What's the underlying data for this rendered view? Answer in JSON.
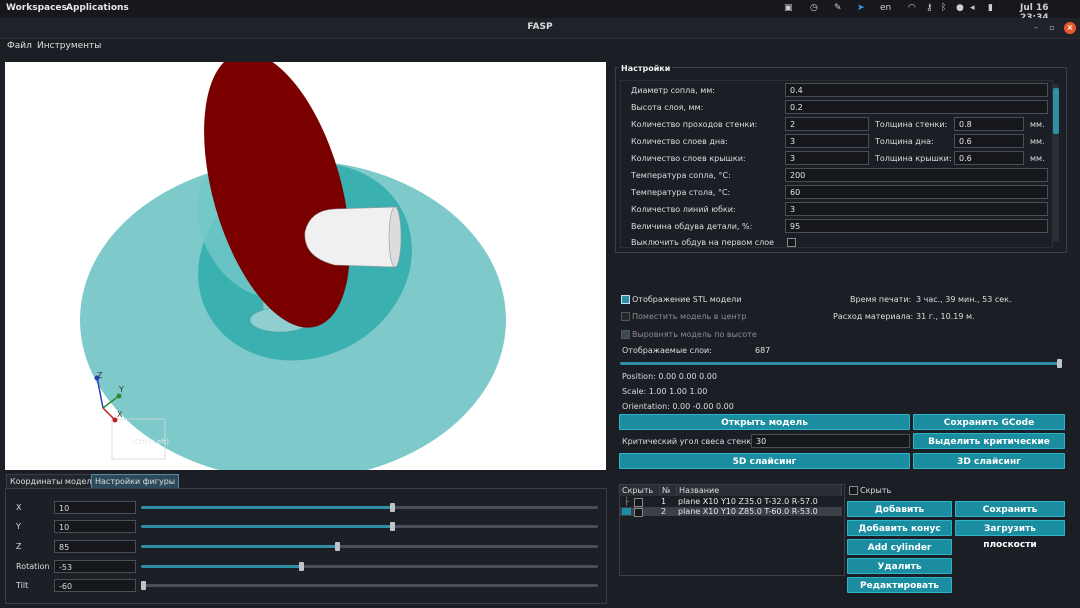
{
  "system_bar": {
    "workspaces": "Workspaces",
    "applications": "Applications",
    "lang": "en",
    "clock": "Jul 16  23:34"
  },
  "window": {
    "title": "FASP"
  },
  "menu": {
    "file": "Файл",
    "tools": "Инструменты"
  },
  "viewport": {
    "corner_label": "(Ctrl+Left)",
    "axis_x": "X",
    "axis_y": "Y",
    "axis_z": "Z"
  },
  "tabs": {
    "model_coords": "Координаты модели",
    "figure_settings": "Настройки фигуры"
  },
  "figure_settings": {
    "rows": [
      {
        "label": "X",
        "value": "10",
        "level": 0.55
      },
      {
        "label": "Y",
        "value": "10",
        "level": 0.55
      },
      {
        "label": "Z",
        "value": "85",
        "level": 0.43
      },
      {
        "label": "Rotation",
        "value": "-53",
        "level": 0.35
      },
      {
        "label": "Tilt",
        "value": "-60",
        "level": 0.0
      }
    ]
  },
  "settings": {
    "title": "Настройки",
    "nozzle_diameter_label": "Диаметр сопла, мм:",
    "nozzle_diameter": "0.4",
    "layer_height_label": "Высота слоя, мм:",
    "layer_height": "0.2",
    "wall_passes_label": "Количество проходов стенки:",
    "wall_passes": "2",
    "wall_thickness_label": "Толщина стенки:",
    "wall_thickness": "0.8",
    "bottom_layers_label": "Количество слоев дна:",
    "bottom_layers": "3",
    "bottom_thickness_label": "Толщина дна:",
    "bottom_thickness": "0.6",
    "top_layers_label": "Количество слоев крышки:",
    "top_layers": "3",
    "top_thickness_label": "Толщина крышки:",
    "top_thickness": "0.6",
    "unit_mm": "мм.",
    "nozzle_temp_label": "Температура сопла, °C:",
    "nozzle_temp": "200",
    "bed_temp_label": "Температура стола, °C:",
    "bed_temp": "60",
    "skirt_lines_label": "Количество линий юбки:",
    "skirt_lines": "3",
    "fan_label": "Величина обдува детали, %:",
    "fan": "95",
    "fan_off_first_label": "Выключить обдув на первом слое"
  },
  "display": {
    "show_stl_label": "Отображение STL модели",
    "center_model_label": "Поместить модель в центр",
    "align_height_label": "Выровнять модель по высоте",
    "layers_label": "Отображаемые слои:",
    "layers_value": "687",
    "layers_level": 1.0,
    "print_time_label": "Время печати:",
    "print_time": "3 час., 39 мин., 53 сек.",
    "material_label": "Расход материала:",
    "material": "31 г., 10.19 м.",
    "position": "Position: 0.00 0.00 0.00",
    "scale": "Scale: 1.00 1.00 1.00",
    "orientation": "Orientation: 0.00 -0.00 0.00"
  },
  "actions": {
    "open_model": "Открыть модель",
    "save_gcode": "Сохранить GCode",
    "crit_angle_label": "Критический угол свеса стенки:",
    "crit_angle": "30",
    "highlight_overhangs": "Выделить критические свесы",
    "slice_5d": "5D слайсинг",
    "slice_3d": "3D слайсинг"
  },
  "planes": {
    "col_hide": "Скрыть",
    "col_num": "№",
    "col_name": "Название",
    "rows": [
      {
        "num": "1",
        "name": "plane X10 Y10 Z35.0 T-32.0 R-57.0"
      },
      {
        "num": "2",
        "name": "plane X10 Y10 Z85.0 T-60.0 R-53.0"
      }
    ],
    "hide_label": "Скрыть",
    "add_plane": "Добавить плоскость",
    "save_planes": "Сохранить плоскости",
    "add_cone": "Добавить конус",
    "load_planes": "Загрузить плоскости",
    "add_cylinder": "Add cylinder",
    "delete": "Удалить",
    "edit": "Редактировать"
  },
  "colors": {
    "accent": "#1a8ea0",
    "disc_red": "#7a0000",
    "plane_teal": "#7ecaca",
    "plane_teal_dark": "#3bb0b0"
  }
}
